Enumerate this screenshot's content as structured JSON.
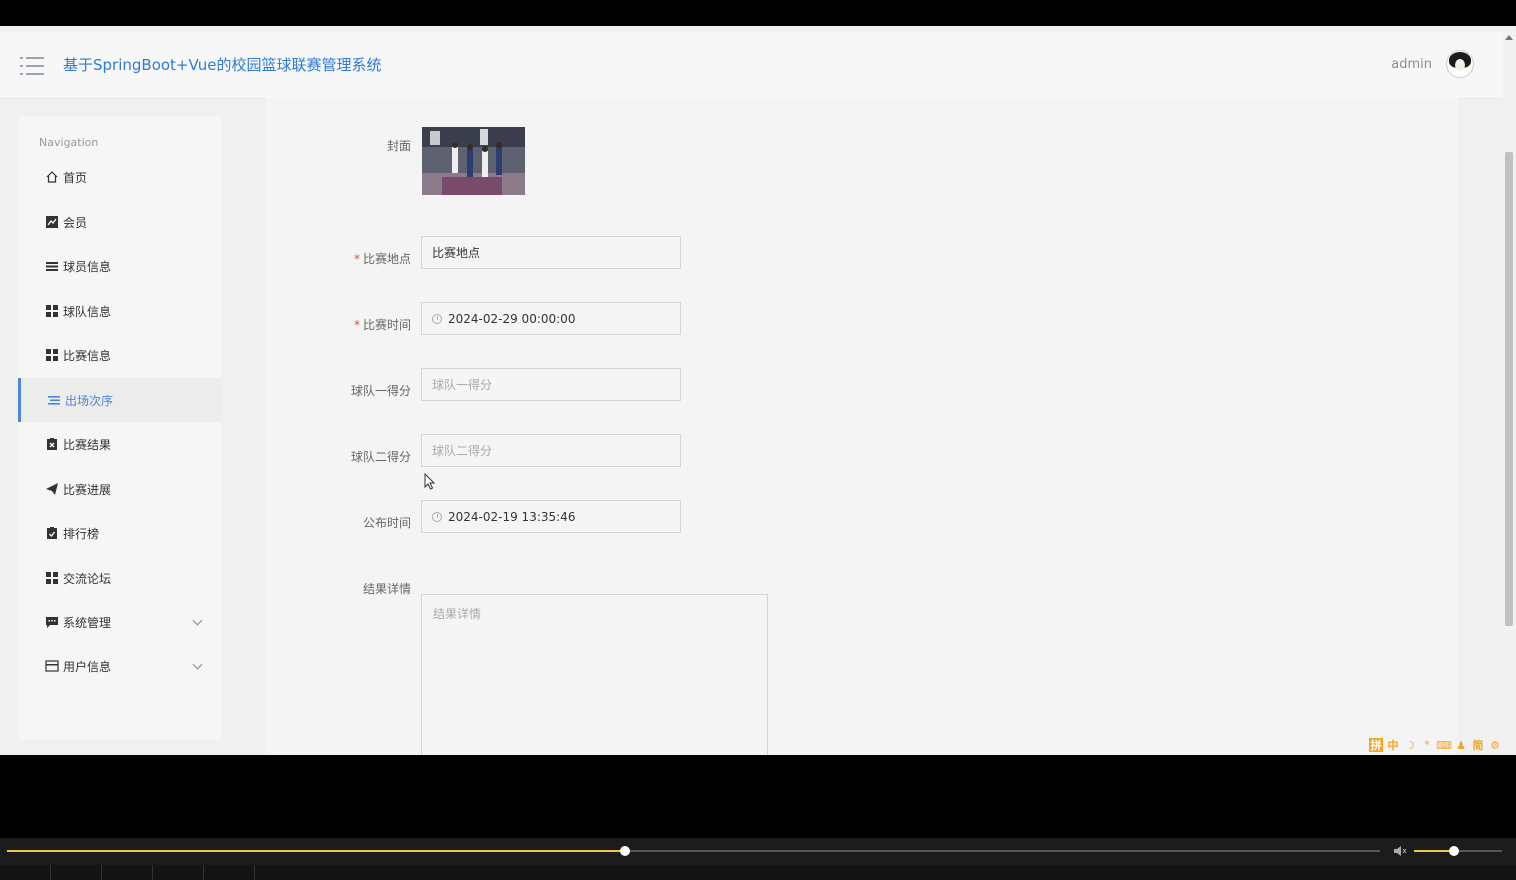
{
  "header": {
    "title": "基于SpringBoot+Vue的校园篮球联赛管理系统",
    "user_name": "admin"
  },
  "sidebar": {
    "nav_title": "Navigation",
    "items": [
      {
        "label": "首页",
        "icon": "home-icon"
      },
      {
        "label": "会员",
        "icon": "chart-icon"
      },
      {
        "label": "球员信息",
        "icon": "list-icon"
      },
      {
        "label": "球队信息",
        "icon": "grid-icon"
      },
      {
        "label": "比赛信息",
        "icon": "grid-icon"
      },
      {
        "label": "出场次序",
        "icon": "list-icon",
        "active": true
      },
      {
        "label": "比赛结果",
        "icon": "clipboard-x-icon"
      },
      {
        "label": "比赛进展",
        "icon": "paper-plane-icon"
      },
      {
        "label": "排行榜",
        "icon": "clipboard-check-icon"
      },
      {
        "label": "交流论坛",
        "icon": "grid-icon"
      },
      {
        "label": "系统管理",
        "icon": "chat-icon",
        "has_children": true
      },
      {
        "label": "用户信息",
        "icon": "card-icon",
        "has_children": true
      }
    ]
  },
  "form": {
    "cover_label": "封面",
    "location": {
      "label": "比赛地点",
      "value": "比赛地点",
      "required": true
    },
    "match_time": {
      "label": "比赛时间",
      "value": "2024-02-29 00:00:00",
      "required": true
    },
    "team1_score": {
      "label": "球队一得分",
      "placeholder": "球队一得分"
    },
    "team2_score": {
      "label": "球队二得分",
      "placeholder": "球队二得分"
    },
    "publish_time": {
      "label": "公布时间",
      "value": "2024-02-19 13:35:46"
    },
    "result_detail": {
      "label": "结果详情",
      "placeholder": "结果详情"
    }
  },
  "ime_toolbar": [
    "拼",
    "中",
    "☽",
    "°",
    "⌨",
    "♟",
    "简",
    "⚙"
  ],
  "player": {
    "progress": 0.45,
    "volume": 0.45
  },
  "colors": {
    "accent": "#2f7bd6",
    "active_nav": "#4c86d8",
    "required": "#e74c3c",
    "player_progress": "#f2c744"
  }
}
